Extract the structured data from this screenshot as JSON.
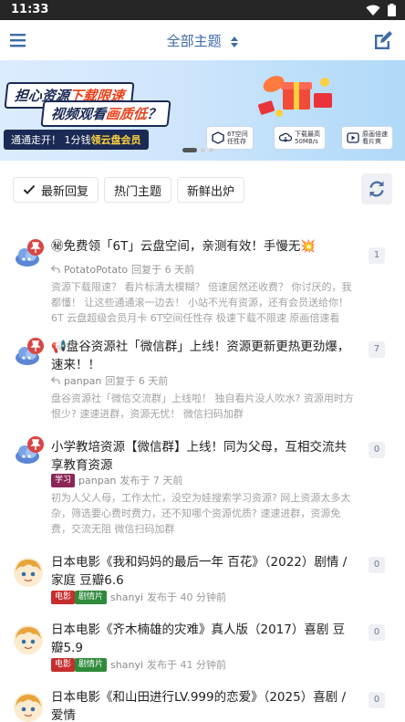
{
  "status_bar": {
    "time": "11:33"
  },
  "header": {
    "title": "全部主题"
  },
  "banner": {
    "headline_1_a": "担心资源",
    "headline_1_b": "下载限速",
    "headline_2_a": "视频观看",
    "headline_2_b": "画质低",
    "headline_2_c": "？",
    "cta_a": "通通走开！ 1分钱",
    "cta_b": "领云盘会员",
    "features": [
      {
        "line1": "6T空间",
        "line2": "任性存"
      },
      {
        "line1": "下载最高",
        "line2": "50MB/s"
      },
      {
        "line1": "原画倍速",
        "line2": "看片爽"
      }
    ]
  },
  "filters": {
    "latest": "最新回复",
    "hot": "热门主题",
    "new": "新鲜出炉"
  },
  "posts": [
    {
      "title": "㊙免费领「6T」云盘空间，亲测有效！手慢无💥",
      "user": "PotatoPotato",
      "action": "回复于 6 天前",
      "excerpt": "资源下载限速？ 看片标清太模糊？ 倍速居然还收费？ 你讨厌的，我都懂！ 让这些通通滚一边去！ 小站不光有资源，还有会员送给你！ 6T 云盘超级会员月卡 6T空间任性存 极速下载不限速 原画倍速看片...",
      "count": "1"
    },
    {
      "title": "📢盘谷资源社「微信群」上线！资源更新更热更劲爆，速来！！",
      "user": "panpan",
      "action": "回复于 6 天前",
      "excerpt": "盘谷资源社「微信交流群」上线啦！ 独自看片没人吹水? 资源用时方恨少? 速速进群，资源无忧！ 微信扫码加群",
      "count": "7"
    },
    {
      "title": "小学教培资源【微信群】上线！同为父母，互相交流共享教育资源",
      "tag": "学习",
      "user": "panpan",
      "action": "发布于 7 天前",
      "excerpt": "初为人父人母，工作太忙，没空为娃搜索学习资源? 网上资源太多太杂，筛选要心费时费力，还不知哪个资源优质? 速速进群，资源免费，交流无阻 微信扫码加群",
      "count": "0"
    },
    {
      "title": "日本电影《我和妈妈的最后一年 百花》（2022）剧情 / 家庭 豆瓣6.6",
      "tags": [
        "电影",
        "剧情片"
      ],
      "user": "shanyi",
      "action": "发布于 40 分钟前",
      "count": "0"
    },
    {
      "title": "日本电影《齐木楠雄的灾难》真人版（2017）喜剧 豆瓣5.9",
      "tags": [
        "电影",
        "剧情片"
      ],
      "user": "shanyi",
      "action": "发布于 41 分钟前",
      "count": "0"
    },
    {
      "title": "日本电影《和山田进行LV.999的恋爱》（2025）喜剧 / 爱情",
      "count": "0"
    }
  ]
}
